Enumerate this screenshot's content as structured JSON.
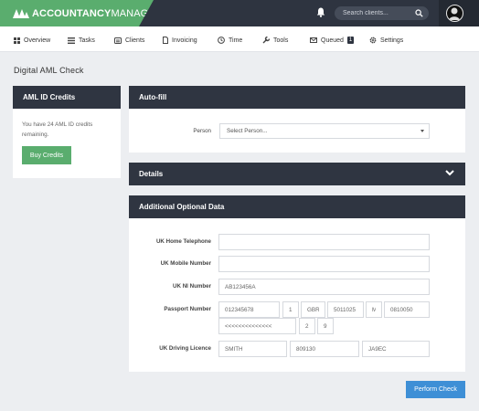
{
  "app": {
    "brand_bold": "ACCOUNTANCY",
    "brand_thin": "MANAGER"
  },
  "header": {
    "search_placeholder": "Search clients..."
  },
  "nav": {
    "items": [
      {
        "label": "Overview",
        "icon": "overview-icon"
      },
      {
        "label": "Tasks",
        "icon": "tasks-icon"
      },
      {
        "label": "Clients",
        "icon": "clients-icon"
      },
      {
        "label": "Invoicing",
        "icon": "invoicing-icon"
      },
      {
        "label": "Time",
        "icon": "clock-icon"
      },
      {
        "label": "Tools",
        "icon": "wrench-icon"
      },
      {
        "label": "Queued",
        "icon": "envelope-icon",
        "badge": "1"
      },
      {
        "label": "Settings",
        "icon": "gear-icon"
      }
    ]
  },
  "page": {
    "title": "Digital AML Check"
  },
  "credits": {
    "title": "AML ID Credits",
    "text": "You have 24 AML ID credits remaining.",
    "button": "Buy Credits"
  },
  "autofill": {
    "title": "Auto-fill",
    "person_label": "Person",
    "person_value": "Select Person..."
  },
  "details": {
    "title": "Details"
  },
  "additional": {
    "title": "Additional Optional Data",
    "home_tel_label": "UK Home Telephone",
    "mobile_label": "UK Mobile Number",
    "ni_label": "UK NI Number",
    "ni_placeholder": "AB123456A",
    "passport_label": "Passport Number",
    "passport_placeholders": [
      "012345678",
      "1",
      "GBR",
      "5011025",
      "M",
      "0810050",
      "<<<<<<<<<<<<<<",
      "2",
      "9"
    ],
    "licence_label": "UK Driving Licence",
    "licence_placeholders": [
      "SMITH",
      "809130",
      "JA9EC"
    ]
  },
  "actions": {
    "perform": "Perform Check"
  },
  "colors": {
    "brand_green": "#5aad6e",
    "header_dark": "#2e3440",
    "panel_head": "#2f3541",
    "primary_blue": "#3e8fd6"
  }
}
